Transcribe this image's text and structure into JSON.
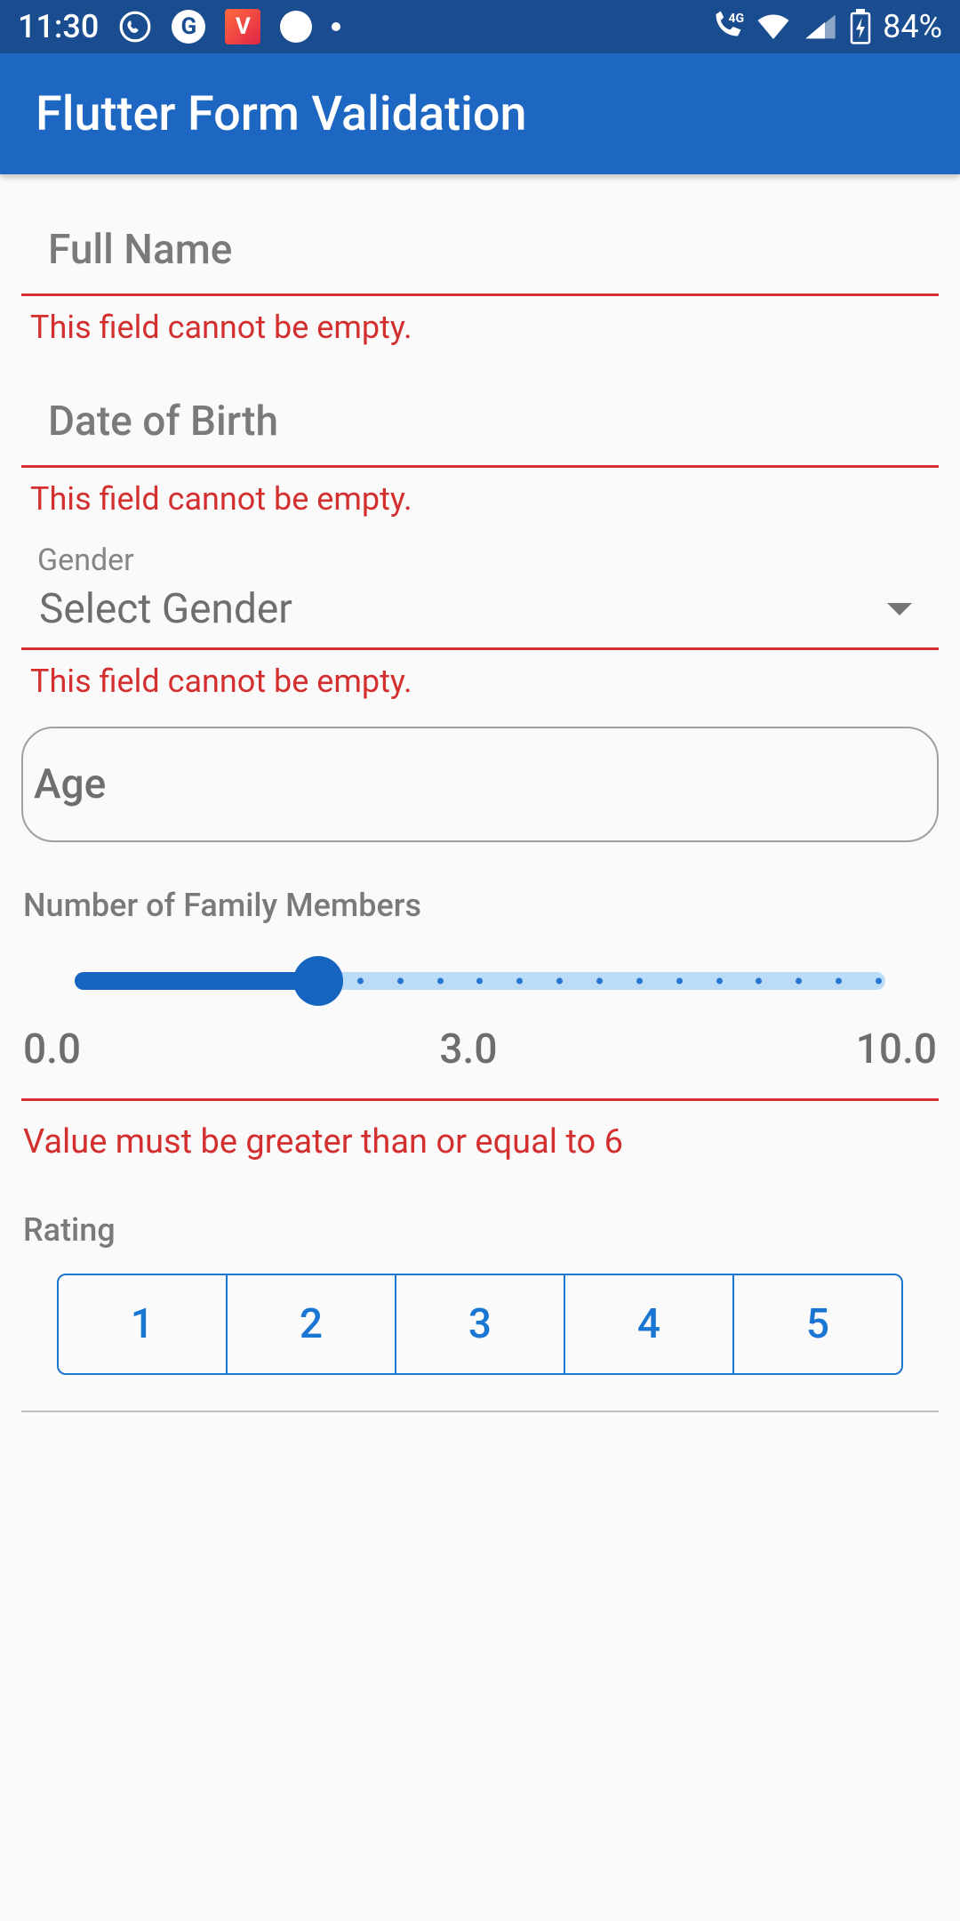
{
  "status": {
    "time": "11:30",
    "battery_pct": "84%",
    "net_label": "4G"
  },
  "appbar": {
    "title": "Flutter Form Validation"
  },
  "form": {
    "full_name": {
      "placeholder": "Full Name",
      "error": "This field cannot be empty."
    },
    "dob": {
      "placeholder": "Date of Birth",
      "error": "This field cannot be empty."
    },
    "gender": {
      "label": "Gender",
      "placeholder": "Select Gender",
      "error": "This field cannot be empty."
    },
    "age": {
      "placeholder": "Age"
    },
    "family": {
      "label": "Number of Family Members",
      "min": "0.0",
      "current": "3.0",
      "max": "10.0",
      "error": "Value must be greater than or equal to 6"
    },
    "rating": {
      "label": "Rating",
      "options": [
        "1",
        "2",
        "3",
        "4",
        "5"
      ]
    }
  }
}
